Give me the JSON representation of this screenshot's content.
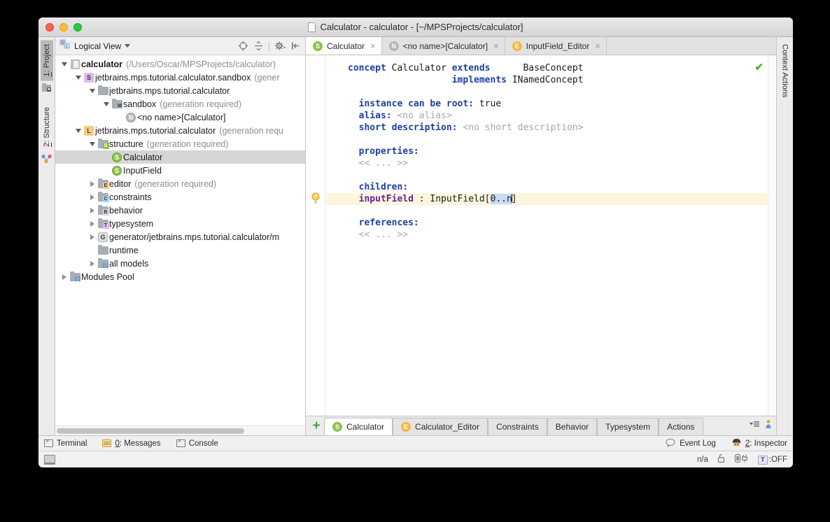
{
  "window": {
    "title": "Calculator - calculator - [~/MPSProjects/calculator]",
    "traffic": {
      "close": "close-window",
      "minimize": "minimize-window",
      "maximize": "maximize-window"
    }
  },
  "left_rail": {
    "items": [
      {
        "label": "1: Project",
        "num": "1",
        "rest": ": Project",
        "active": true
      },
      {
        "label": "2: Structure",
        "num": "2",
        "rest": ": Structure",
        "active": false
      }
    ]
  },
  "right_rail": {
    "items": [
      {
        "label": "Context Actions"
      }
    ]
  },
  "project_panel": {
    "view_selector": "Logical View",
    "tools": [
      "locate-icon",
      "collapse-all-icon",
      "settings-icon",
      "hide-icon"
    ],
    "tree": [
      {
        "indent": 0,
        "twist": "down",
        "icon": "project-icon",
        "label": "calculator",
        "bold": true,
        "sub": "(/Users/Oscar/MPSProjects/calculator)",
        "selected": false
      },
      {
        "indent": 1,
        "twist": "down",
        "icon": "badge-s-purple",
        "label": "jetbrains.mps.tutorial.calculator.sandbox",
        "bold": false,
        "sub": "(gener",
        "selected": false
      },
      {
        "indent": 2,
        "twist": "down",
        "icon": "folder-plain",
        "label": "jetbrains.mps.tutorial.calculator",
        "bold": false,
        "sub": "",
        "selected": false
      },
      {
        "indent": 3,
        "twist": "down",
        "icon": "folder-m",
        "label": "sandbox",
        "bold": false,
        "sub": "(generation required)",
        "selected": false
      },
      {
        "indent": 4,
        "twist": "none",
        "icon": "circle-n-gray",
        "label": "<no name>[Calculator]",
        "bold": false,
        "sub": "",
        "selected": false
      },
      {
        "indent": 1,
        "twist": "down",
        "icon": "badge-l-orange",
        "label": "jetbrains.mps.tutorial.calculator",
        "bold": false,
        "sub": "(generation requ",
        "selected": false
      },
      {
        "indent": 2,
        "twist": "down",
        "icon": "folder-s",
        "label": "structure",
        "bold": false,
        "sub": "(generation required)",
        "selected": false
      },
      {
        "indent": 3,
        "twist": "none",
        "icon": "circle-s-green",
        "label": "Calculator",
        "bold": false,
        "sub": "",
        "selected": true
      },
      {
        "indent": 3,
        "twist": "none",
        "icon": "circle-s-green",
        "label": "InputField",
        "bold": false,
        "sub": "",
        "selected": false
      },
      {
        "indent": 2,
        "twist": "right",
        "icon": "folder-e",
        "label": "editor",
        "bold": false,
        "sub": "(generation required)",
        "selected": false
      },
      {
        "indent": 2,
        "twist": "right",
        "icon": "folder-c",
        "label": "constraints",
        "bold": false,
        "sub": "",
        "selected": false
      },
      {
        "indent": 2,
        "twist": "right",
        "icon": "folder-b",
        "label": "behavior",
        "bold": false,
        "sub": "",
        "selected": false
      },
      {
        "indent": 2,
        "twist": "right",
        "icon": "folder-t",
        "label": "typesystem",
        "bold": false,
        "sub": "",
        "selected": false
      },
      {
        "indent": 2,
        "twist": "right",
        "icon": "badge-g-gray",
        "label": "generator/jetbrains.mps.tutorial.calculator/m",
        "bold": false,
        "sub": "",
        "selected": false
      },
      {
        "indent": 2,
        "twist": "none",
        "icon": "folder-plain",
        "label": "runtime",
        "bold": false,
        "sub": "",
        "selected": false
      },
      {
        "indent": 2,
        "twist": "right",
        "icon": "modules-icon",
        "label": "all models",
        "bold": false,
        "sub": "",
        "selected": false
      },
      {
        "indent": 0,
        "twist": "right",
        "icon": "modules-icon",
        "label": "Modules Pool",
        "bold": false,
        "sub": "",
        "selected": false
      }
    ]
  },
  "editor": {
    "tabs": [
      {
        "label": "Calculator",
        "icon": "s",
        "active": true,
        "close": "×"
      },
      {
        "label": "<no name>[Calculator]",
        "icon": "n",
        "active": false,
        "close": "×"
      },
      {
        "label": "InputField_Editor",
        "icon": "e",
        "active": false,
        "close": "×"
      }
    ],
    "ok_check": "✔",
    "code_lines": [
      {
        "id": "l1",
        "hl": false,
        "parts": [
          {
            "t": "concept ",
            "c": "kw"
          },
          {
            "t": "Calculator ",
            "c": "pl"
          },
          {
            "t": "extends",
            "c": "kw"
          },
          {
            "t": "      ",
            "c": "pl"
          },
          {
            "t": "BaseConcept",
            "c": "pl"
          }
        ]
      },
      {
        "id": "l2",
        "hl": false,
        "parts": [
          {
            "t": "                   ",
            "c": "pl"
          },
          {
            "t": "implements",
            "c": "kw"
          },
          {
            "t": " INamedConcept",
            "c": "pl"
          }
        ]
      },
      {
        "id": "l3",
        "hl": false,
        "parts": [
          {
            "t": "",
            "c": "pl"
          }
        ]
      },
      {
        "id": "l4",
        "hl": false,
        "parts": [
          {
            "t": "  instance can be root:",
            "c": "kw"
          },
          {
            "t": " true",
            "c": "pl"
          }
        ]
      },
      {
        "id": "l5",
        "hl": false,
        "parts": [
          {
            "t": "  alias:",
            "c": "kw"
          },
          {
            "t": " <no alias>",
            "c": "gr"
          }
        ]
      },
      {
        "id": "l6",
        "hl": false,
        "parts": [
          {
            "t": "  short description:",
            "c": "kw"
          },
          {
            "t": " <no short description>",
            "c": "gr"
          }
        ]
      },
      {
        "id": "l7",
        "hl": false,
        "parts": [
          {
            "t": "",
            "c": "pl"
          }
        ]
      },
      {
        "id": "l8",
        "hl": false,
        "parts": [
          {
            "t": "  properties:",
            "c": "kw"
          }
        ]
      },
      {
        "id": "l9",
        "hl": false,
        "parts": [
          {
            "t": "  << ... >>",
            "c": "gr"
          }
        ]
      },
      {
        "id": "l10",
        "hl": false,
        "parts": [
          {
            "t": "",
            "c": "pl"
          }
        ]
      },
      {
        "id": "l11",
        "hl": false,
        "parts": [
          {
            "t": "  children:",
            "c": "kw"
          }
        ]
      },
      {
        "id": "l12",
        "hl": true,
        "parts": [
          {
            "t": "  inputField",
            "c": "purp"
          },
          {
            "t": " : InputField[",
            "c": "pl"
          },
          {
            "t": "0..n",
            "c": "selblue"
          },
          {
            "t": "│",
            "c": "caret"
          },
          {
            "t": "]",
            "c": "pl"
          }
        ]
      },
      {
        "id": "l13",
        "hl": false,
        "parts": [
          {
            "t": "",
            "c": "pl"
          }
        ]
      },
      {
        "id": "l14",
        "hl": false,
        "parts": [
          {
            "t": "  references:",
            "c": "kw"
          }
        ]
      },
      {
        "id": "l15",
        "hl": false,
        "parts": [
          {
            "t": "  << ... >>",
            "c": "gr"
          }
        ]
      }
    ],
    "bottom_tabs": [
      {
        "label": "Calculator",
        "icon": "s",
        "active": true
      },
      {
        "label": "Calculator_Editor",
        "icon": "e",
        "active": false
      },
      {
        "label": "Constraints",
        "icon": "none",
        "active": false
      },
      {
        "label": "Behavior",
        "icon": "none",
        "active": false
      },
      {
        "label": "Typesystem",
        "icon": "none",
        "active": false
      },
      {
        "label": "Actions",
        "icon": "none",
        "active": false
      }
    ],
    "add_tab_label": "+"
  },
  "status_bar": {
    "left": [
      {
        "label": "Terminal",
        "icon": "terminal-icon",
        "num": "",
        "rest": "Terminal"
      },
      {
        "label": "0: Messages",
        "icon": "messages-icon",
        "num": "0",
        "rest": ": Messages"
      },
      {
        "label": "Console",
        "icon": "console-icon",
        "num": "",
        "rest": "Console"
      }
    ],
    "right": [
      {
        "label": "Event Log",
        "icon": "event-log-icon",
        "num": "",
        "rest": "Event Log"
      },
      {
        "label": "2: Inspector",
        "icon": "inspector-icon",
        "num": "2",
        "rest": ": Inspector"
      }
    ]
  },
  "bottom_bar": {
    "memory_or_pos": "n/a",
    "lock_icon": "unlocked-icon",
    "plug_icon": "plug-icon",
    "toggle_key": "T",
    "toggle_state": ":OFF"
  }
}
